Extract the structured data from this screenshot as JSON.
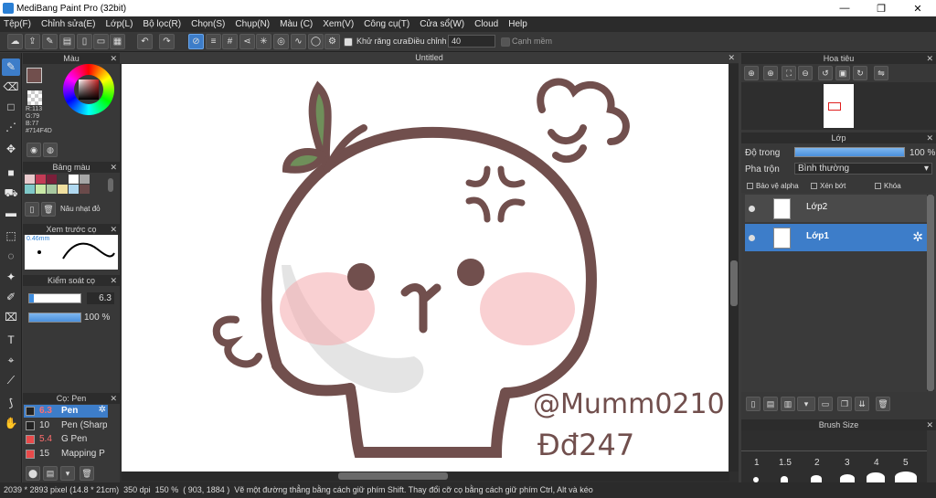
{
  "window": {
    "title": "MediBang Paint Pro (32bit)",
    "minimize": "—",
    "restore": "❐",
    "close": "✕"
  },
  "menu": [
    "Tệp(F)",
    "Chỉnh sửa(E)",
    "Lớp(L)",
    "Bộ lọc(R)",
    "Chọn(S)",
    "Chụp(N)",
    "Màu (C)",
    "Xem(V)",
    "Công cụ(T)",
    "Cửa sổ(W)",
    "Cloud",
    "Help"
  ],
  "toolbar": {
    "antialias_label": "Khử răng cưa",
    "correction_label": "Điều chỉnh",
    "correction_value": "40",
    "edge_label": "Cạnh mềm"
  },
  "color_panel": {
    "title": "Màu",
    "r": "R:113",
    "g": "G:79",
    "b": "B:77",
    "hex": "#714F4D",
    "current_color": "#714F4D"
  },
  "palette_panel": {
    "title": "Bảng màu",
    "label": "Nâu nhạt đỏ",
    "swatches": [
      "#e8c9cc",
      "#c43b56",
      "#7a1f3a",
      "#3a3a3a",
      "#ffffff",
      "#a6a6a6",
      "#7fc8c8",
      "#c8e8a6",
      "#a8c8a0",
      "#f0e0a0",
      "#b0d8f0",
      "#6a4a4a"
    ]
  },
  "brush_preview": {
    "title": "Xem trước cọ",
    "size": "0.46mm"
  },
  "brush_control": {
    "title": "Kiểm soát cọ",
    "size_value": "6.3",
    "opacity_value": "100 %"
  },
  "brush_list": {
    "title": "Cọ: Pen",
    "items": [
      {
        "size": "6.3",
        "name": "Pen",
        "color": "#222222"
      },
      {
        "size": "10",
        "name": "Pen (Sharp",
        "color": "#222222"
      },
      {
        "size": "5.4",
        "name": "G Pen",
        "color": "#e84a4a"
      },
      {
        "size": "15",
        "name": "Mapping P",
        "color": "#e84a4a"
      }
    ]
  },
  "canvas": {
    "tab_title": "Untitled"
  },
  "navigator": {
    "title": "Hoa tiêu"
  },
  "layer_panel": {
    "title": "Lớp",
    "opacity_label": "Độ trong",
    "opacity_value": "100 %",
    "blend_label": "Pha trộn",
    "blend_value": "Bình thường",
    "protect_alpha": "Bảo vệ alpha",
    "clipping": "Xén bớt",
    "lock": "Khóa",
    "layers": [
      {
        "name": "Lớp2"
      },
      {
        "name": "Lớp1"
      }
    ]
  },
  "brush_size_panel": {
    "title": "Brush Size",
    "sizes": [
      "1",
      "1.5",
      "2",
      "3",
      "4",
      "5"
    ]
  },
  "status": {
    "size": "2039 * 2893 pixel",
    "physical": "(14.8 * 21cm)",
    "dpi": "350 dpi",
    "zoom": "150 %",
    "coords": "( 903, 1884 )",
    "hint": "Vẽ một đường thẳng bằng cách giữ phím Shift. Thay đổi cỡ cọ bằng cách giữ phím Ctrl, Alt và kéo"
  },
  "artwork": {
    "signature_line1": "@Mumm0210",
    "signature_line2": "Đđ247",
    "stroke_color": "#714F4D"
  }
}
